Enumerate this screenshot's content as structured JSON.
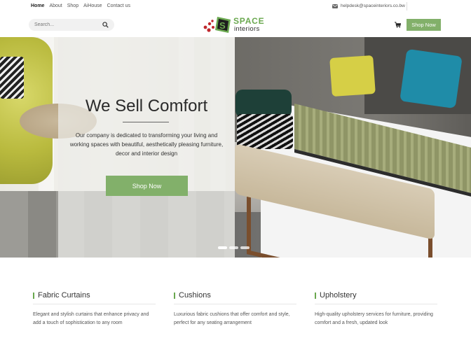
{
  "topbar": {
    "nav": [
      {
        "label": "Home",
        "active": true
      },
      {
        "label": "About",
        "active": false
      },
      {
        "label": "Shop",
        "active": false
      },
      {
        "label": "AiHouse",
        "active": false
      },
      {
        "label": "Contact us",
        "active": false
      }
    ],
    "email": "helpdesk@spaceinteriors.co.bw"
  },
  "header": {
    "search_placeholder": "Search...",
    "logo_top": "SPACE",
    "logo_bottom": "interiors",
    "shop_button": "Shop Now"
  },
  "hero": {
    "title": "We Sell Comfort",
    "text": "Our company is dedicated to transforming your living and working spaces with beautiful, aesthetically pleasing furniture, decor and interior design",
    "button": "Shop Now",
    "slides": 3,
    "active_slide": 1
  },
  "features": [
    {
      "title": "Fabric Curtains",
      "description": "Elegant and stylish curtains that enhance privacy and add a touch of sophistication to any room"
    },
    {
      "title": "Cushions",
      "description": "Luxurious fabric cushions that offer comfort and style, perfect for any seating arrangement"
    },
    {
      "title": "Upholstery",
      "description": "High-quality upholstery services for furniture, providing comfort and a fresh, updated look"
    }
  ],
  "colors": {
    "accent": "#82b06a",
    "logo_green": "#6aa84f",
    "logo_red": "#c0282d"
  }
}
